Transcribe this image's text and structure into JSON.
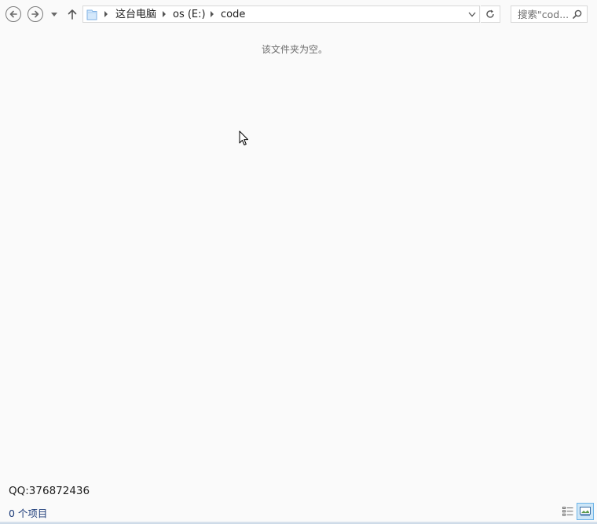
{
  "navigation": {
    "back_icon": "arrow-left-circle-icon",
    "forward_icon": "arrow-right-circle-icon",
    "recent_icon": "chevron-down-icon",
    "up_icon": "arrow-up-icon"
  },
  "address": {
    "location_icon": "folder-icon",
    "breadcrumbs": [
      "这台电脑",
      "os (E:)",
      "code"
    ],
    "dropdown_icon": "chevron-down-icon",
    "refresh_icon": "refresh-icon"
  },
  "search": {
    "placeholder": "搜索\"cod...",
    "icon": "search-icon"
  },
  "content": {
    "empty_message": "该文件夹为空。",
    "overlay_text": "QQ:376872436"
  },
  "statusbar": {
    "item_count": "0 个项目",
    "views": [
      {
        "name": "details-view",
        "icon": "details-view-icon",
        "active": false
      },
      {
        "name": "large-icons-view",
        "icon": "large-icons-view-icon",
        "active": true
      }
    ]
  },
  "colors": {
    "accent": "#6cb4e8",
    "status_text": "#1b3a78",
    "muted_text": "#6d6d6d"
  }
}
